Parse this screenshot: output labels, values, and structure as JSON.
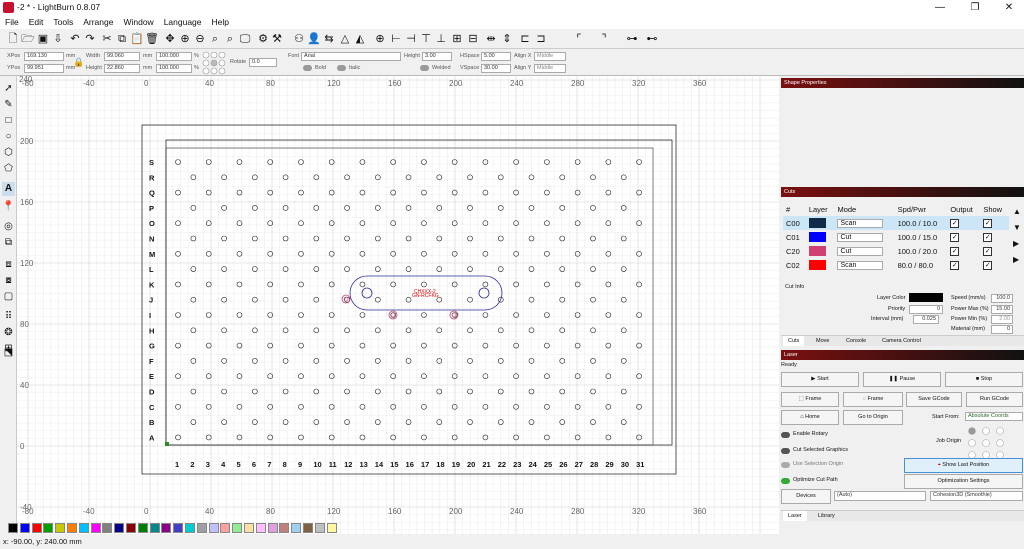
{
  "window": {
    "title": "-2 * - LightBurn 0.8.07",
    "minimize": "—",
    "maximize": "❐",
    "close": "✕"
  },
  "menu": [
    "File",
    "Edit",
    "Tools",
    "Arrange",
    "Window",
    "Language",
    "Help"
  ],
  "props": {
    "xpos_label": "XPos",
    "xpos": "169.130",
    "ypos_label": "YPos",
    "ypos": "99.951",
    "unit": "mm",
    "width_label": "Width",
    "width": "99.060",
    "height_label": "Height",
    "height": "22.860",
    "pct_w": "100.000",
    "pct_h": "100.000",
    "pct": "%",
    "rotate_label": "Rotate",
    "rotate": "0.0",
    "font_label": "Font",
    "font": "Arial",
    "fheight_label": "Height",
    "fheight": "3.00",
    "hspace_label": "HSpace",
    "hspace": "5.00",
    "vspace_label": "VSpace",
    "vspace": "30.00",
    "alignx_label": "Align X",
    "alignx": "Middle",
    "aligny_label": "Align Y",
    "aligny": "Middle",
    "bold": "Bold",
    "italic": "Italic",
    "welded": "Welded"
  },
  "rulers": {
    "top": [
      "-80",
      "-40",
      "0",
      "40",
      "80",
      "120",
      "160",
      "200",
      "240",
      "280",
      "320",
      "360"
    ],
    "top_partial": "240",
    "left": [
      "200",
      "160",
      "120",
      "80",
      "40",
      "0",
      "-40"
    ],
    "left_partial": "240",
    "bottom": [
      "-80",
      "-40",
      "0",
      "40",
      "80",
      "120",
      "160",
      "200",
      "240",
      "280",
      "320",
      "360"
    ]
  },
  "grid": {
    "rows": [
      "S",
      "R",
      "Q",
      "P",
      "O",
      "N",
      "M",
      "L",
      "K",
      "J",
      "I",
      "H",
      "G",
      "F",
      "E",
      "D",
      "C",
      "B",
      "A"
    ],
    "cols": [
      "1",
      "2",
      "3",
      "4",
      "5",
      "6",
      "7",
      "8",
      "9",
      "10",
      "11",
      "12",
      "13",
      "14",
      "15",
      "16",
      "17",
      "18",
      "19",
      "20",
      "21",
      "22",
      "23",
      "24",
      "25",
      "26",
      "27",
      "28",
      "29",
      "30",
      "31"
    ]
  },
  "canvas_text": {
    "line1": "CHXXX-2",
    "line2": "GN-RCFKG"
  },
  "panels": {
    "shape_properties": "Shape Properties",
    "cuts": "Cuts",
    "laser": "Laser"
  },
  "cuts": {
    "headers": [
      "#",
      "Layer",
      "Mode",
      "Spd/Pwr",
      "Output",
      "Show"
    ],
    "rows": [
      {
        "id": "C00",
        "color": "#102a48",
        "mode": "Scan",
        "spdpwr": "100.0 / 10.0"
      },
      {
        "id": "C01",
        "color": "#0000ff",
        "mode": "Cut",
        "spdpwr": "100.0 / 15.0"
      },
      {
        "id": "C20",
        "color": "#d04070",
        "mode": "Cut",
        "spdpwr": "100.0 / 20.0"
      },
      {
        "id": "C02",
        "color": "#ff0000",
        "mode": "Scan",
        "spdpwr": "80.0 / 80.0"
      }
    ]
  },
  "cutinfo": {
    "title": "Cut Info",
    "layer_color": "Layer Color",
    "priority": "Priority",
    "priority_val": "0",
    "interval": "Interval (mm)",
    "interval_val": "0.025",
    "speed": "Speed (mm/s)",
    "speed_val": "100.0",
    "pmax": "Power Max (%)",
    "pmax_val": "15.00",
    "pmin": "Power Min (%)",
    "pmin_val": "2.00",
    "material": "Material (mm)",
    "material_val": "0"
  },
  "tabs1": [
    "Cuts",
    "Move",
    "Console",
    "Camera Control"
  ],
  "laser": {
    "status": "Ready",
    "start": "Start",
    "pause": "Pause",
    "stop": "Stop",
    "frame1": "Frame",
    "frame2": "Frame",
    "save_gcode": "Save GCode",
    "run_gcode": "Run GCode",
    "home": "Home",
    "goto_origin": "Go to Origin",
    "start_from": "Start From:",
    "start_from_val": "Absolute Coords",
    "enable_rotary": "Enable Rotary",
    "job_origin": "Job Origin",
    "cut_selected": "Cut Selected Graphics",
    "use_selection_origin": "Use Selection Origin",
    "show_last": "Show Last Position",
    "optimize": "Optimize Cut Path",
    "opt_settings": "Optimization Settings",
    "devices": "Devices",
    "device_val": "(Auto)",
    "profile_val": "Cohesion3D (Smoothie)"
  },
  "tabs2": [
    "Laser",
    "Library"
  ],
  "palette": [
    "#000000",
    "#0000ff",
    "#ff0000",
    "#00a000",
    "#c8c800",
    "#ff8000",
    "#00c0ff",
    "#ff00ff",
    "#808080",
    "#00008b",
    "#8b0000",
    "#008000",
    "#008b8b",
    "#8b008b",
    "#4040c0",
    "#00ced1",
    "#a0a0a0",
    "#c0c0ff",
    "#ffa0a0",
    "#90ee90",
    "#ffe0a0",
    "#ffc0ff",
    "#e0a0e0",
    "#c08080",
    "#a0d0f0",
    "#806040",
    "#c0c0c0",
    "#fff8a0"
  ],
  "status": "x: -90.00, y: 240.00 mm"
}
